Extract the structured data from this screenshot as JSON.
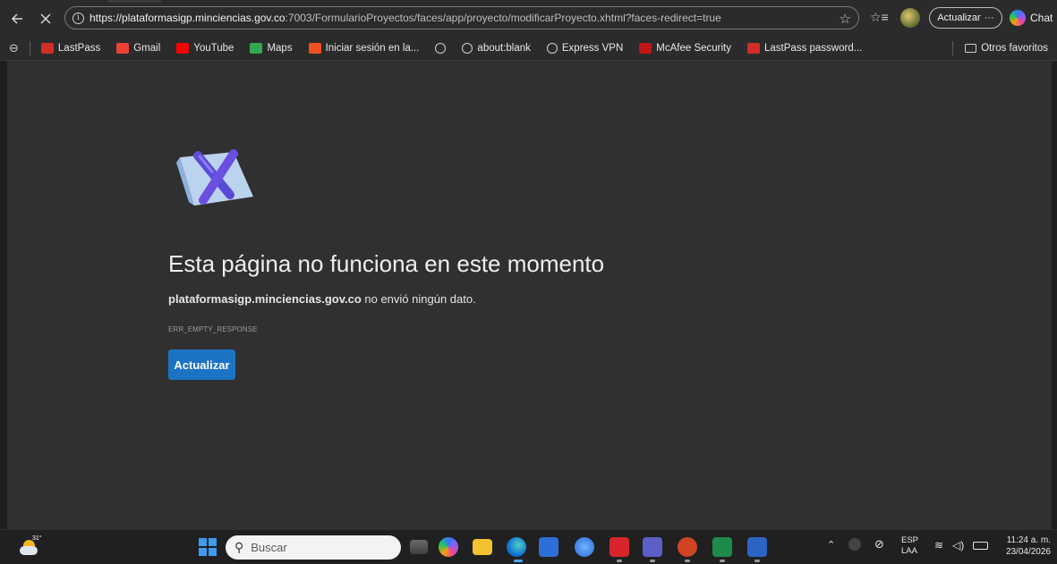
{
  "browser": {
    "url_host": "https://plataformasigp.minciencias.gov.co",
    "url_rest": ":7003/FormularioProyectos/faces/app/proyecto/modificarProyecto.xhtml?faces-redirect=true",
    "update_label": "Actualizar",
    "update_more": "···",
    "chat_label": "Chat"
  },
  "bookmarks": {
    "items": [
      {
        "label": "LastPass",
        "icon": "lastpass-icon",
        "color": "#d32d27"
      },
      {
        "label": "Gmail",
        "icon": "gmail-icon",
        "color": "#ea4335"
      },
      {
        "label": "YouTube",
        "icon": "youtube-icon",
        "color": "#ff0000"
      },
      {
        "label": "Maps",
        "icon": "maps-icon",
        "color": "#34a853"
      },
      {
        "label": "Iniciar sesión en la...",
        "icon": "microsoft-icon",
        "color": "#f25022"
      },
      {
        "label": "",
        "icon": "globe-icon",
        "color": "#d0d0d0"
      },
      {
        "label": "about:blank",
        "icon": "globe-icon",
        "color": "#d0d0d0"
      },
      {
        "label": "Express VPN",
        "icon": "globe-icon",
        "color": "#d0d0d0"
      },
      {
        "label": "McAfee Security",
        "icon": "mcafee-icon",
        "color": "#c01818"
      },
      {
        "label": "LastPass password...",
        "icon": "lastpass-icon",
        "color": "#d32d27"
      }
    ],
    "other_favorites": "Otros favoritos"
  },
  "error_page": {
    "title": "Esta página no funciona en este momento",
    "host": "plataformasigp.minciencias.gov.co",
    "message": " no envió ningún dato.",
    "code": "ERR_EMPTY_RESPONSE",
    "reload_label": "Actualizar"
  },
  "taskbar": {
    "weather_temp": "31°",
    "search_placeholder": "Buscar",
    "lang_line1": "ESP",
    "lang_line2": "LAA",
    "time": "11:24 a. m.",
    "date": "23/04/2026"
  }
}
